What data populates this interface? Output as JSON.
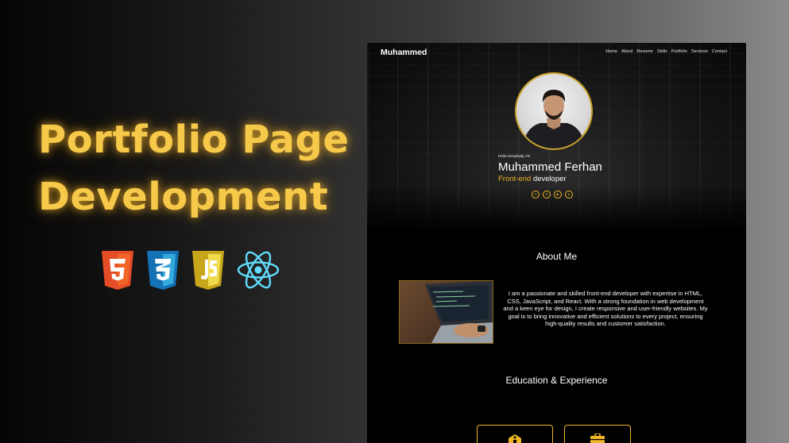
{
  "hero": {
    "title_line1": "Portfolio Page",
    "title_line2": "Development",
    "tech_icons": [
      "html5-icon",
      "css3-icon",
      "javascript-icon",
      "react-icon"
    ]
  },
  "preview": {
    "nav": {
      "brand": "Muhammed",
      "items": [
        "Home",
        "About",
        "Resume",
        "Skills",
        "Portfolio",
        "Services",
        "Contact"
      ]
    },
    "intro": {
      "greeting": "Hello everybody, I'm",
      "name": "Muhammed Ferhan",
      "role_accent": "Front-end",
      "role_rest": " developer",
      "socials": [
        "linkedin-icon",
        "instagram-icon",
        "youtube-icon",
        "github-icon"
      ]
    },
    "about": {
      "title": "About Me",
      "text": "I am a passionate and skilled front-end developer with expertise in HTML, CSS, JavaScript, and React. With a strong foundation in web development and a keen eye for design, I create responsive and user-friendly websites. My goal is to bring innovative and efficient solutions to every project, ensuring high-quality results and customer satisfaction."
    },
    "education": {
      "title": "Education & Experience",
      "cards": [
        "school-icon",
        "briefcase-icon"
      ]
    }
  },
  "colors": {
    "accent": "#f0b527",
    "headline": "#f7c94a",
    "preview_bg": "#000000"
  }
}
